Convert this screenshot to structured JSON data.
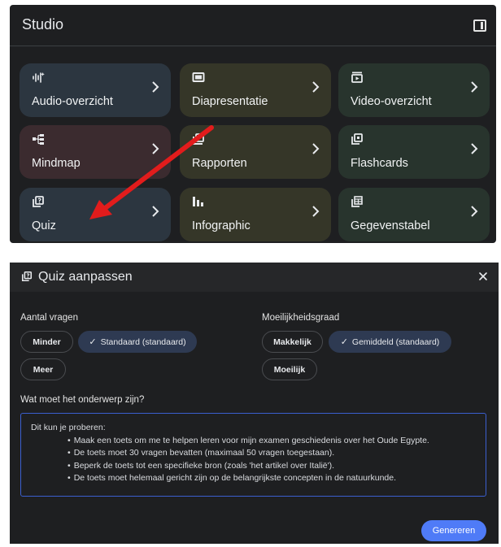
{
  "studio": {
    "title": "Studio",
    "tiles": [
      {
        "label": "Audio-overzicht",
        "icon": "audio-waveform-icon"
      },
      {
        "label": "Diapresentatie",
        "icon": "slides-icon"
      },
      {
        "label": "Video-overzicht",
        "icon": "video-icon"
      },
      {
        "label": "Mindmap",
        "icon": "mindmap-icon"
      },
      {
        "label": "Rapporten",
        "icon": "reports-icon"
      },
      {
        "label": "Flashcards",
        "icon": "flashcards-icon"
      },
      {
        "label": "Quiz",
        "icon": "quiz-icon"
      },
      {
        "label": "Infographic",
        "icon": "infographic-icon"
      },
      {
        "label": "Gegevenstabel",
        "icon": "table-icon"
      }
    ],
    "tile_colors": {
      "blue": "#2c3640",
      "olive": "#353628",
      "green": "#28342d",
      "rose": "#3b2b2f"
    },
    "annotation_arrow_color": "#e21c1c"
  },
  "dialog": {
    "title": "Quiz aanpassen",
    "count_label": "Aantal vragen",
    "count_options": [
      "Minder",
      "Standaard (standaard)",
      "Meer"
    ],
    "count_selected": "Standaard (standaard)",
    "difficulty_label": "Moeilijkheidsgraad",
    "difficulty_options": [
      "Makkelijk",
      "Gemiddeld (standaard)",
      "Moeilijk"
    ],
    "difficulty_selected": "Gemiddeld (standaard)",
    "topic_label": "Wat moet het onderwerp zijn?",
    "placeholder": {
      "intro": "Dit kun je proberen:",
      "items": [
        "Maak een toets om me te helpen leren voor mijn examen geschiedenis over het Oude Egypte.",
        "De toets moet 30 vragen bevatten (maximaal 50 vragen toegestaan).",
        "Beperk de toets tot een specifieke bron (zoals 'het artikel over Italië').",
        "De toets moet helemaal gericht zijn op de belangrijkste concepten in de natuurkunde."
      ]
    },
    "generate_label": "Genereren",
    "accent": "#4f7bf7"
  }
}
